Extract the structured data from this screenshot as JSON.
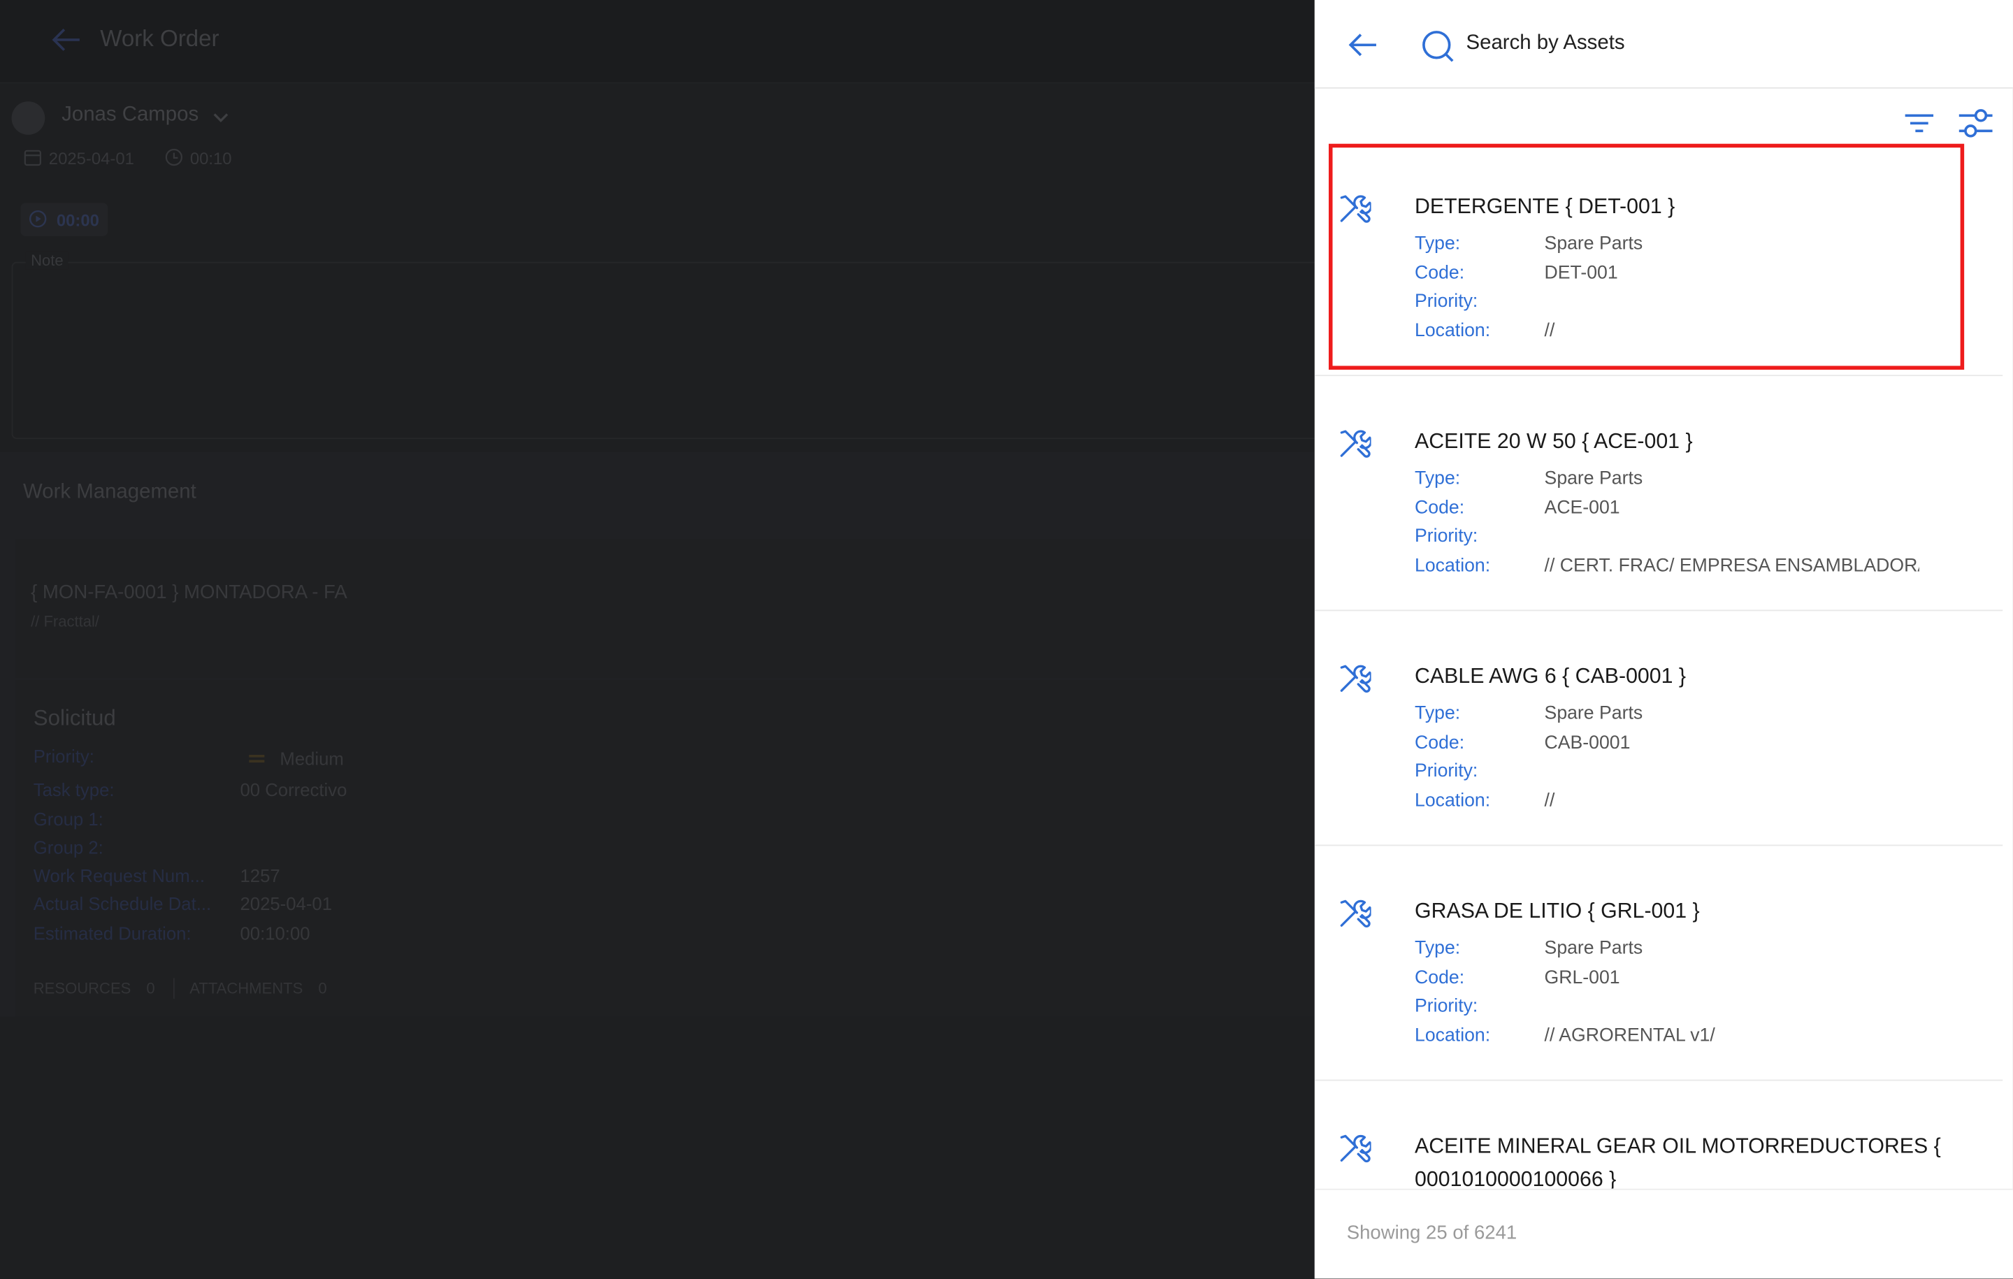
{
  "background": {
    "header_title": "Work Order",
    "user_name": "Jonas Campos",
    "date": "2025-04-01",
    "duration": "00:10",
    "timer": "00:00",
    "note_label": "Note",
    "section_title": "Work Management",
    "asset_title": "{ MON-FA-0001 } MONTADORA - FA",
    "asset_path": "// Fracttal/",
    "request_title": "Solicitud",
    "fields": [
      {
        "label": "Priority:",
        "value": "Medium"
      },
      {
        "label": "Task type:",
        "value": "00 Correctivo"
      },
      {
        "label": "Group 1:",
        "value": ""
      },
      {
        "label": "Group 2:",
        "value": ""
      },
      {
        "label": "Work Request Num...",
        "value": "1257"
      },
      {
        "label": "Actual Schedule Dat...",
        "value": "2025-04-01"
      },
      {
        "label": "Estimated Duration:",
        "value": "00:10:00"
      }
    ],
    "tabs": [
      {
        "label": "RESOURCES",
        "count": "0"
      },
      {
        "label": "ATTACHMENTS",
        "count": "0"
      }
    ]
  },
  "panel": {
    "search_placeholder": "Search by Assets",
    "labels": {
      "type": "Type:",
      "code": "Code:",
      "priority": "Priority:",
      "location": "Location:"
    },
    "items": [
      {
        "title": "DETERGENTE { DET-001 }",
        "type": "Spare Parts",
        "code": "DET-001",
        "priority": "",
        "location": "//"
      },
      {
        "title": "ACEITE 20 W 50 { ACE-001 }",
        "type": "Spare Parts",
        "code": "ACE-001",
        "priority": "",
        "location": "// CERT. FRAC/ EMPRESA ENSAMBLADORA"
      },
      {
        "title": "CABLE AWG 6 { CAB-0001 }",
        "type": "Spare Parts",
        "code": "CAB-0001",
        "priority": "",
        "location": "//"
      },
      {
        "title": "GRASA DE LITIO { GRL-001 }",
        "type": "Spare Parts",
        "code": "GRL-001",
        "priority": "",
        "location": "// AGRORENTAL v1/"
      },
      {
        "title": "ACEITE MINERAL GEAR OIL MOTORREDUCTORES { 0001010000100066 }",
        "type": "",
        "code": "",
        "priority": "",
        "location": ""
      }
    ],
    "footer_text": "Showing 25 of 6241"
  },
  "colors": {
    "accent": "#2f6fd6",
    "highlight": "#ee1c1c"
  }
}
